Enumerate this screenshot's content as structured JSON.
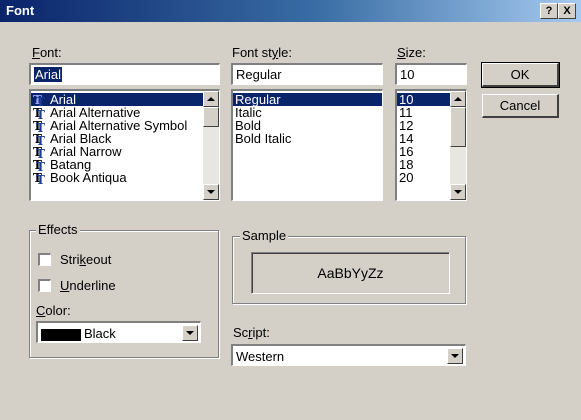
{
  "window": {
    "title": "Font",
    "help_button": "?",
    "close_button": "X"
  },
  "font": {
    "label": "Font:",
    "value": "Arial",
    "items": [
      {
        "label": "Arial",
        "selected": true
      },
      {
        "label": "Arial Alternative",
        "selected": false
      },
      {
        "label": "Arial Alternative Symbol",
        "selected": false
      },
      {
        "label": "Arial Black",
        "selected": false
      },
      {
        "label": "Arial Narrow",
        "selected": false
      },
      {
        "label": "Batang",
        "selected": false
      },
      {
        "label": "Book Antiqua",
        "selected": false
      }
    ]
  },
  "style": {
    "label": "Font style:",
    "value": "Regular",
    "items": [
      {
        "label": "Regular",
        "selected": true
      },
      {
        "label": "Italic",
        "selected": false
      },
      {
        "label": "Bold",
        "selected": false
      },
      {
        "label": "Bold Italic",
        "selected": false
      }
    ]
  },
  "size": {
    "label": "Size:",
    "value": "10",
    "items": [
      {
        "label": "10",
        "selected": true
      },
      {
        "label": "11",
        "selected": false
      },
      {
        "label": "12",
        "selected": false
      },
      {
        "label": "14",
        "selected": false
      },
      {
        "label": "16",
        "selected": false
      },
      {
        "label": "18",
        "selected": false
      },
      {
        "label": "20",
        "selected": false
      }
    ]
  },
  "buttons": {
    "ok": "OK",
    "cancel": "Cancel"
  },
  "effects": {
    "title": "Effects",
    "strikeout": "Strikeout",
    "underline": "Underline",
    "strikeout_checked": false,
    "underline_checked": false,
    "color_label": "Color:",
    "color_value": "Black",
    "color_hex": "#000000"
  },
  "sample": {
    "title": "Sample",
    "text": "AaBbYyZz"
  },
  "script": {
    "label": "Script:",
    "value": "Western"
  }
}
